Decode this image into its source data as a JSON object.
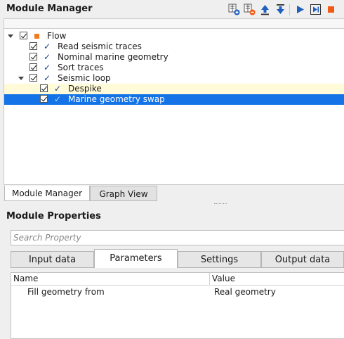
{
  "module_manager": {
    "title": "Module Manager",
    "toolbar": [
      {
        "icon": "add-module-icon",
        "tooltip": ""
      },
      {
        "icon": "remove-module-icon",
        "tooltip": ""
      },
      {
        "icon": "move-up-icon",
        "tooltip": ""
      },
      {
        "icon": "move-down-icon",
        "tooltip": ""
      },
      {
        "icon": "run-icon",
        "tooltip": ""
      },
      {
        "icon": "step-run-icon",
        "tooltip": ""
      },
      {
        "icon": "stop-icon",
        "tooltip": ""
      }
    ],
    "tree": {
      "root": {
        "label": "Flow",
        "checked": true,
        "expanded": true
      },
      "items": [
        {
          "label": "Read seismic traces",
          "checked": true
        },
        {
          "label": "Nominal marine geometry",
          "checked": true
        },
        {
          "label": "Sort traces",
          "checked": true
        },
        {
          "label": "Seismic loop",
          "checked": true,
          "expanded": true,
          "children": [
            {
              "label": "Despike",
              "checked": true,
              "highlighted": true
            },
            {
              "label": "Marine geometry swap",
              "checked": true,
              "selected": true
            }
          ]
        }
      ]
    },
    "tabs": [
      {
        "label": "Module Manager",
        "active": true
      },
      {
        "label": "Graph View",
        "active": false
      }
    ]
  },
  "module_properties": {
    "title": "Module Properties",
    "search_placeholder": "Search Property",
    "tabs": [
      {
        "label": "Input data",
        "active": false
      },
      {
        "label": "Parameters",
        "active": true
      },
      {
        "label": "Settings",
        "active": false
      },
      {
        "label": "Output data",
        "active": false
      }
    ],
    "table": {
      "columns": [
        "Name",
        "Value"
      ],
      "rows": [
        {
          "name": "Fill geometry from",
          "value": "Real geometry"
        }
      ]
    }
  },
  "colors": {
    "selection": "#1473e6",
    "highlight_row": "#fffbd8",
    "check_blue": "#1e3f8c",
    "flow_orange": "#f07a1e",
    "run_blue": "#1f5fbf",
    "stop_orange": "#f05a14"
  }
}
